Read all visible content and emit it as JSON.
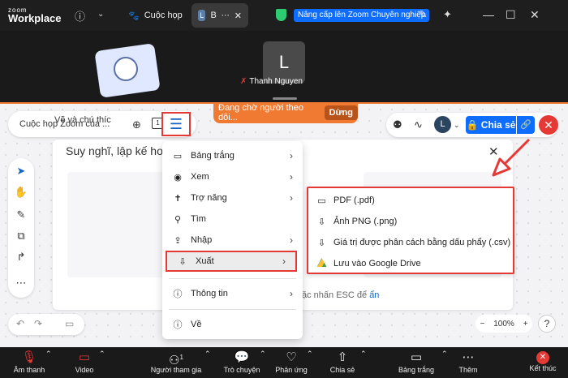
{
  "topbar": {
    "logo_small": "zoom",
    "logo_big": "Workplace",
    "tab_meeting": "Cuộc họp",
    "tab_board_letter": "B",
    "upgrade_label": "Nâng cấp lên Zoom Chuyên nghiệp"
  },
  "meeting": {
    "avatar_initial": "L",
    "participant_name": "Thanh Nguyen"
  },
  "whiteboard": {
    "waiting_text": "Đang chờ người theo dõi...",
    "stop_label": "Dừng",
    "board_title": "Cuộc họp Zoom của ...",
    "pages_count": "1",
    "user_initial": "L",
    "share_label": "Chia sẻ",
    "template_title": "Suy nghĩ, lập kế ho",
    "card_label": "Vẽ và chú thíc",
    "esc_hint": "ặc nhấn ESC để",
    "esc_link": "ẩn",
    "zoom_level": "100%"
  },
  "menu": {
    "items": [
      {
        "label": "Bảng trắng",
        "icon": "whiteboard-icon",
        "glyph": "▭",
        "has_submenu": true
      },
      {
        "label": "Xem",
        "icon": "eye-icon",
        "glyph": "◉",
        "has_submenu": true
      },
      {
        "label": "Trợ năng",
        "icon": "accessibility-icon",
        "glyph": "✝",
        "has_submenu": true
      },
      {
        "label": "Tìm",
        "icon": "search-icon",
        "glyph": "⚲",
        "has_submenu": false
      },
      {
        "label": "Nhập",
        "icon": "import-icon",
        "glyph": "⇪",
        "has_submenu": true
      },
      {
        "label": "Xuất",
        "icon": "export-icon",
        "glyph": "⇩",
        "has_submenu": true
      },
      {
        "label": "Thông tin",
        "icon": "info-icon",
        "glyph": "ⓘ",
        "has_submenu": true
      },
      {
        "label": "Về",
        "icon": "about-icon",
        "glyph": "ⓘ",
        "has_submenu": false
      }
    ]
  },
  "export_submenu": [
    {
      "label": "PDF (.pdf)",
      "icon": "pdf-export-icon"
    },
    {
      "label": "Ảnh PNG (.png)",
      "icon": "png-export-icon"
    },
    {
      "label": "Giá trị được phân cách bằng dấu phẩy (.csv)",
      "icon": "csv-export-icon"
    },
    {
      "label": "Lưu vào Google Drive",
      "icon": "google-drive-icon"
    }
  ],
  "controls": {
    "audio": "Âm thanh",
    "video": "Video",
    "participants": "Người tham gia",
    "participants_count": "1",
    "chat": "Trò chuyện",
    "reactions": "Phản ứng",
    "share": "Chia sẻ",
    "whiteboard": "Bảng trắng",
    "more": "Thêm",
    "end": "Kết thúc"
  },
  "colors": {
    "accent_orange": "#f07a32",
    "highlight_red": "#e53935",
    "brand_blue": "#0e6cff"
  }
}
